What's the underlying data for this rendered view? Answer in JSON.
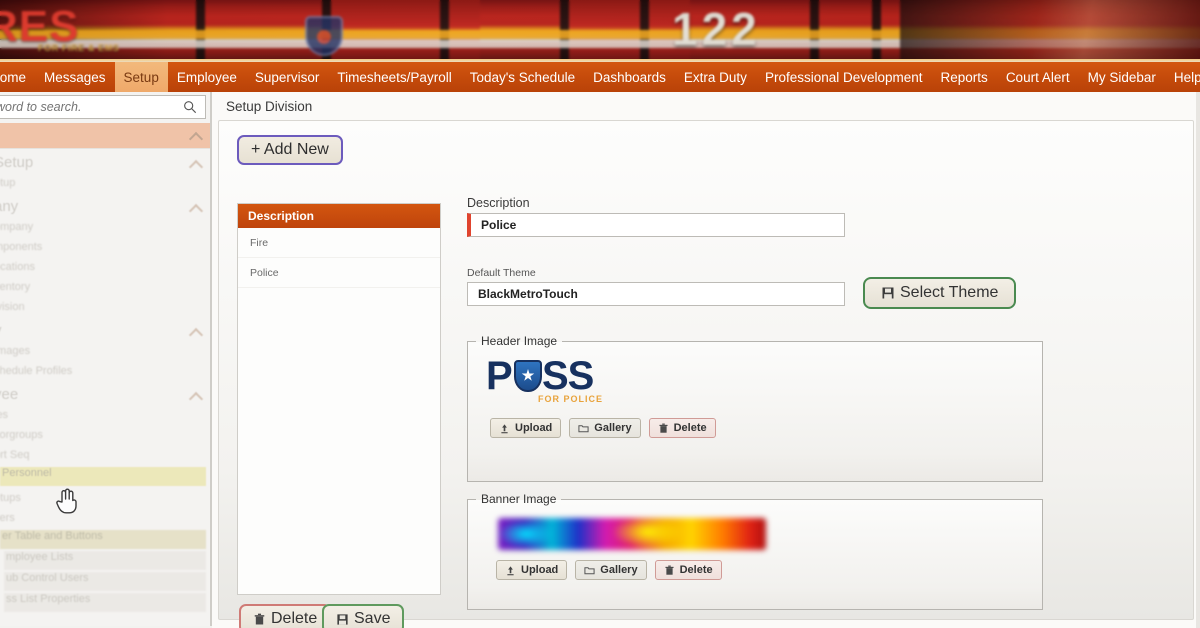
{
  "banner": {
    "logo_text": "RES",
    "logo_subtitle": "FOR FIRE & EMS",
    "truck_number": "122"
  },
  "nav": {
    "items": [
      {
        "label": "Home",
        "active": false
      },
      {
        "label": "Messages",
        "active": false
      },
      {
        "label": "Setup",
        "active": true
      },
      {
        "label": "Employee",
        "active": false
      },
      {
        "label": "Supervisor",
        "active": false
      },
      {
        "label": "Timesheets/Payroll",
        "active": false
      },
      {
        "label": "Today's Schedule",
        "active": false
      },
      {
        "label": "Dashboards",
        "active": false
      },
      {
        "label": "Extra Duty",
        "active": false
      },
      {
        "label": "Professional Development",
        "active": false
      },
      {
        "label": "Reports",
        "active": false
      },
      {
        "label": "Court Alert",
        "active": false
      },
      {
        "label": "My Sidebar",
        "active": false
      },
      {
        "label": "Help",
        "active": false
      }
    ]
  },
  "sidebar": {
    "search_placeholder": "word to search.",
    "search_value": "",
    "groups": [
      {
        "title": "Setup",
        "items": [
          "etup"
        ]
      },
      {
        "title": "any",
        "items": [
          "ompany",
          "mponents",
          "ocations",
          "ventory",
          "ivision"
        ]
      },
      {
        "title": "y",
        "items": [
          "Images",
          "chedule Profiles"
        ]
      },
      {
        "title": "yee",
        "items": [
          "les",
          "korgroups",
          "ort Seq",
          "Personnel",
          "etups",
          "sers",
          "er Table and Buttons",
          "mployee Lists",
          "ub Control Users",
          "ss List Properties"
        ]
      }
    ]
  },
  "breadcrumb": "Setup Division",
  "toolbar": {
    "add_new_label": "+ Add New"
  },
  "list": {
    "header": "Description",
    "rows": [
      "Fire",
      "Police"
    ]
  },
  "form": {
    "description_label": "Description",
    "description_value": "Police",
    "theme_label": "Default Theme",
    "theme_value": "BlackMetroTouch",
    "select_theme_label": "Select Theme",
    "header_image_legend": "Header Image",
    "banner_image_legend": "Banner Image",
    "header_logo": {
      "letter_p": "P",
      "letters_ss": "SS",
      "tagline": "FOR POLICE"
    },
    "image_buttons": {
      "upload": "Upload",
      "gallery": "Gallery",
      "delete": "Delete"
    }
  },
  "footer": {
    "delete_label": "Delete",
    "save_label": "Save"
  },
  "colors": {
    "nav_orange": "#c44a0b",
    "nav_active": "#efa96a",
    "list_header": "#d35610",
    "required_marker": "#e0442e",
    "addnew_border": "#6c5bbd",
    "save_border": "#5f9a5e",
    "delete_border": "#cf7b76",
    "logo_navy": "#17315f",
    "logo_gold": "#e8a33c"
  }
}
